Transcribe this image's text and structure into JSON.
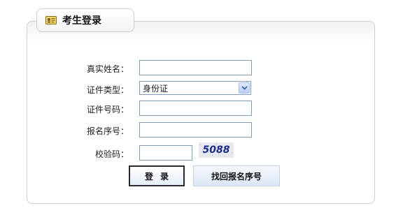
{
  "panel": {
    "title": "考生登录",
    "title_icon": "id-card-icon"
  },
  "form": {
    "name_label": "真实姓名：",
    "name_value": "",
    "idtype_label": "证件类型：",
    "idtype_selected": "身份证",
    "idnumber_label": "证件号码：",
    "idnumber_value": "",
    "regno_label": "报名序号：",
    "regno_value": "",
    "captcha_label": "校验码：",
    "captcha_value": "",
    "captcha_image_text": "5088"
  },
  "buttons": {
    "login": "登录",
    "retrieve": "找回报名序号"
  }
}
